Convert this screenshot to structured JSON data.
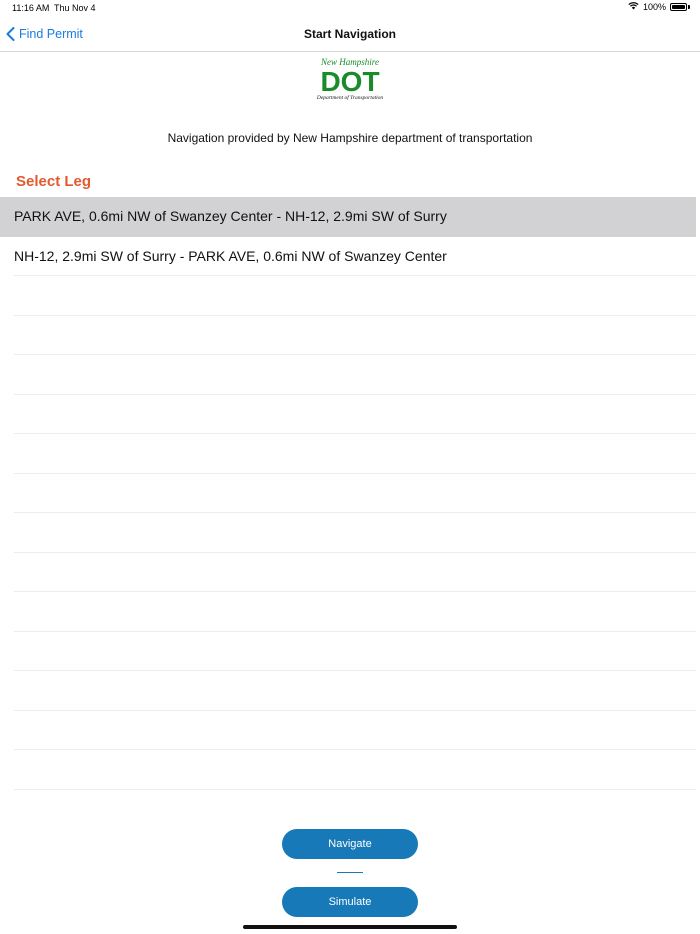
{
  "status_bar": {
    "time": "11:16 AM",
    "date": "Thu Nov 4",
    "battery": "100%"
  },
  "nav": {
    "back_label": "Find Permit",
    "title": "Start Navigation"
  },
  "logo": {
    "line1": "New Hampshire",
    "line2": "DOT",
    "line3": "Department of Transportation",
    "color": "#1a8a2a"
  },
  "credit": "Navigation provided by New Hampshire department of transportation",
  "section_title": "Select Leg",
  "legs": [
    {
      "label": "PARK AVE, 0.6mi NW of Swanzey Center - NH-12, 2.9mi SW of Surry",
      "selected": true
    },
    {
      "label": "NH-12, 2.9mi SW of Surry - PARK AVE, 0.6mi NW of Swanzey Center",
      "selected": false
    }
  ],
  "buttons": {
    "navigate": "Navigate",
    "simulate": "Simulate"
  },
  "colors": {
    "accent": "#1a7ce0",
    "button": "#1779b8",
    "section_title": "#e35a2e",
    "selected_row": "#d2d2d4"
  }
}
